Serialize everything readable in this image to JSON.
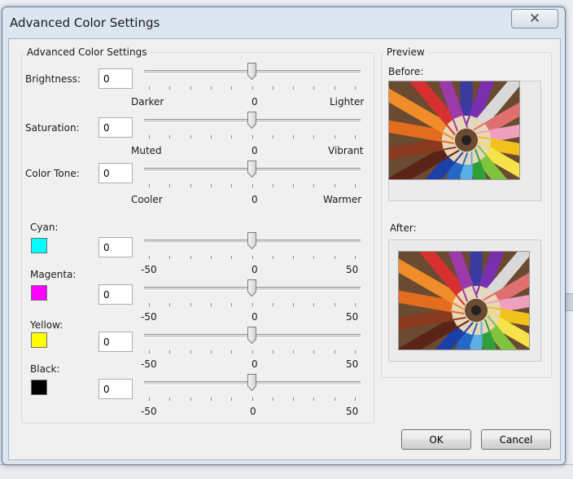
{
  "dialog": {
    "title": "Advanced Color Settings",
    "close_glyph": "✕"
  },
  "group": {
    "label": "Advanced Color Settings"
  },
  "tone": {
    "brightness": {
      "label": "Brightness:",
      "value": "0",
      "left": "Darker",
      "mid": "0",
      "right": "Lighter"
    },
    "saturation": {
      "label": "Saturation:",
      "value": "0",
      "left": "Muted",
      "mid": "0",
      "right": "Vibrant"
    },
    "color_tone": {
      "label": "Color Tone:",
      "value": "0",
      "left": "Cooler",
      "mid": "0",
      "right": "Warmer"
    }
  },
  "channels": {
    "cyan": {
      "label": "Cyan:",
      "value": "0",
      "min": "-50",
      "mid": "0",
      "max": "50",
      "color": "#00ffff"
    },
    "magenta": {
      "label": "Magenta:",
      "value": "0",
      "min": "-50",
      "mid": "0",
      "max": "50",
      "color": "#ff00ff"
    },
    "yellow": {
      "label": "Yellow:",
      "value": "0",
      "min": "-50",
      "mid": "0",
      "max": "50",
      "color": "#ffff00"
    },
    "black": {
      "label": "Black:",
      "value": "0",
      "min": "-50",
      "mid": "0",
      "max": "50",
      "color": "#000000"
    }
  },
  "preview": {
    "label": "Preview",
    "before": "Before:",
    "after": "After:"
  },
  "buttons": {
    "ok": "OK",
    "cancel": "Cancel"
  }
}
